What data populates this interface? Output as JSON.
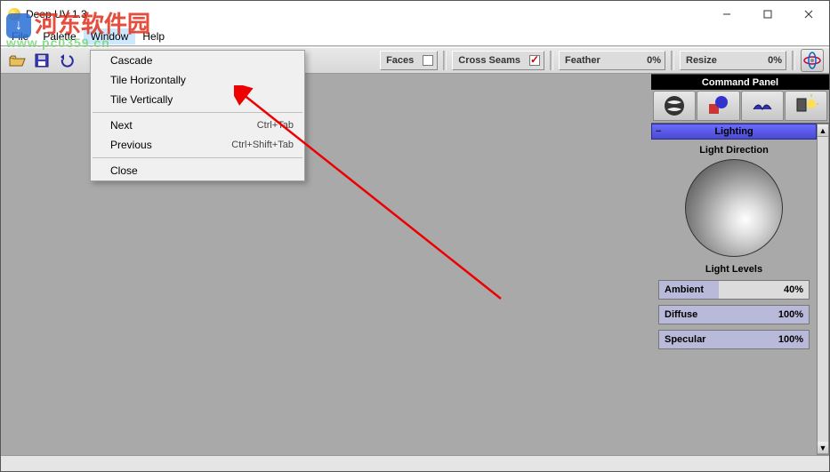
{
  "window": {
    "title": "Deep UV 1.3",
    "controls": {
      "min": "—",
      "max": "☐",
      "close": "✕"
    }
  },
  "menubar": [
    "File",
    "Palette",
    "Window",
    "Help"
  ],
  "active_menu_index": 2,
  "toolbar": {
    "faces": {
      "label": "Faces",
      "checked": false
    },
    "cross_seams": {
      "label": "Cross Seams",
      "checked": true
    },
    "feather": {
      "label": "Feather",
      "value": "0%"
    },
    "resize": {
      "label": "Resize",
      "value": "0%"
    }
  },
  "dropdown": {
    "items": [
      {
        "label": "Cascade",
        "accel": ""
      },
      {
        "label": "Tile Horizontally",
        "accel": ""
      },
      {
        "label": "Tile Vertically",
        "accel": ""
      },
      {
        "sep": true
      },
      {
        "label": "Next",
        "accel": "Ctrl+Tab"
      },
      {
        "label": "Previous",
        "accel": "Ctrl+Shift+Tab"
      },
      {
        "sep": true
      },
      {
        "label": "Close",
        "accel": ""
      }
    ]
  },
  "command_panel": {
    "title": "Command Panel",
    "section": "Lighting",
    "light_direction_label": "Light Direction",
    "light_levels_label": "Light Levels",
    "levels": {
      "ambient": {
        "label": "Ambient",
        "value": "40%",
        "fill": 40
      },
      "diffuse": {
        "label": "Diffuse",
        "value": "100%",
        "fill": 100
      },
      "specular": {
        "label": "Specular",
        "value": "100%",
        "fill": 100
      }
    }
  },
  "watermark": {
    "line1": "河东软件园",
    "line2": "www.pc0359.cn"
  }
}
